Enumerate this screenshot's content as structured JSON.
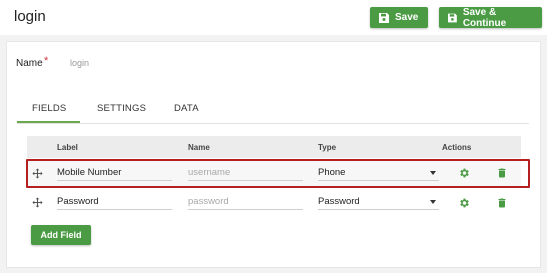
{
  "header": {
    "title": "login",
    "save_label": "Save",
    "save_continue_label": "Save & Continue"
  },
  "form": {
    "name_label": "Name",
    "required_mark": "*",
    "name_value": "login"
  },
  "tabs": [
    {
      "label": "FIELDS",
      "active": true
    },
    {
      "label": "SETTINGS",
      "active": false
    },
    {
      "label": "DATA",
      "active": false
    }
  ],
  "table": {
    "columns": [
      "Label",
      "Name",
      "Type",
      "Actions"
    ],
    "rows": [
      {
        "label": "Mobile Number",
        "name_placeholder": "username",
        "type": "Phone",
        "highlighted": true
      },
      {
        "label": "Password",
        "name_placeholder": "password",
        "type": "Password",
        "highlighted": false
      }
    ]
  },
  "add_field_label": "Add Field",
  "colors": {
    "accent_green": "#4b9a44",
    "highlight_red": "#b51f1f",
    "tab_underline": "#6aa84f"
  }
}
